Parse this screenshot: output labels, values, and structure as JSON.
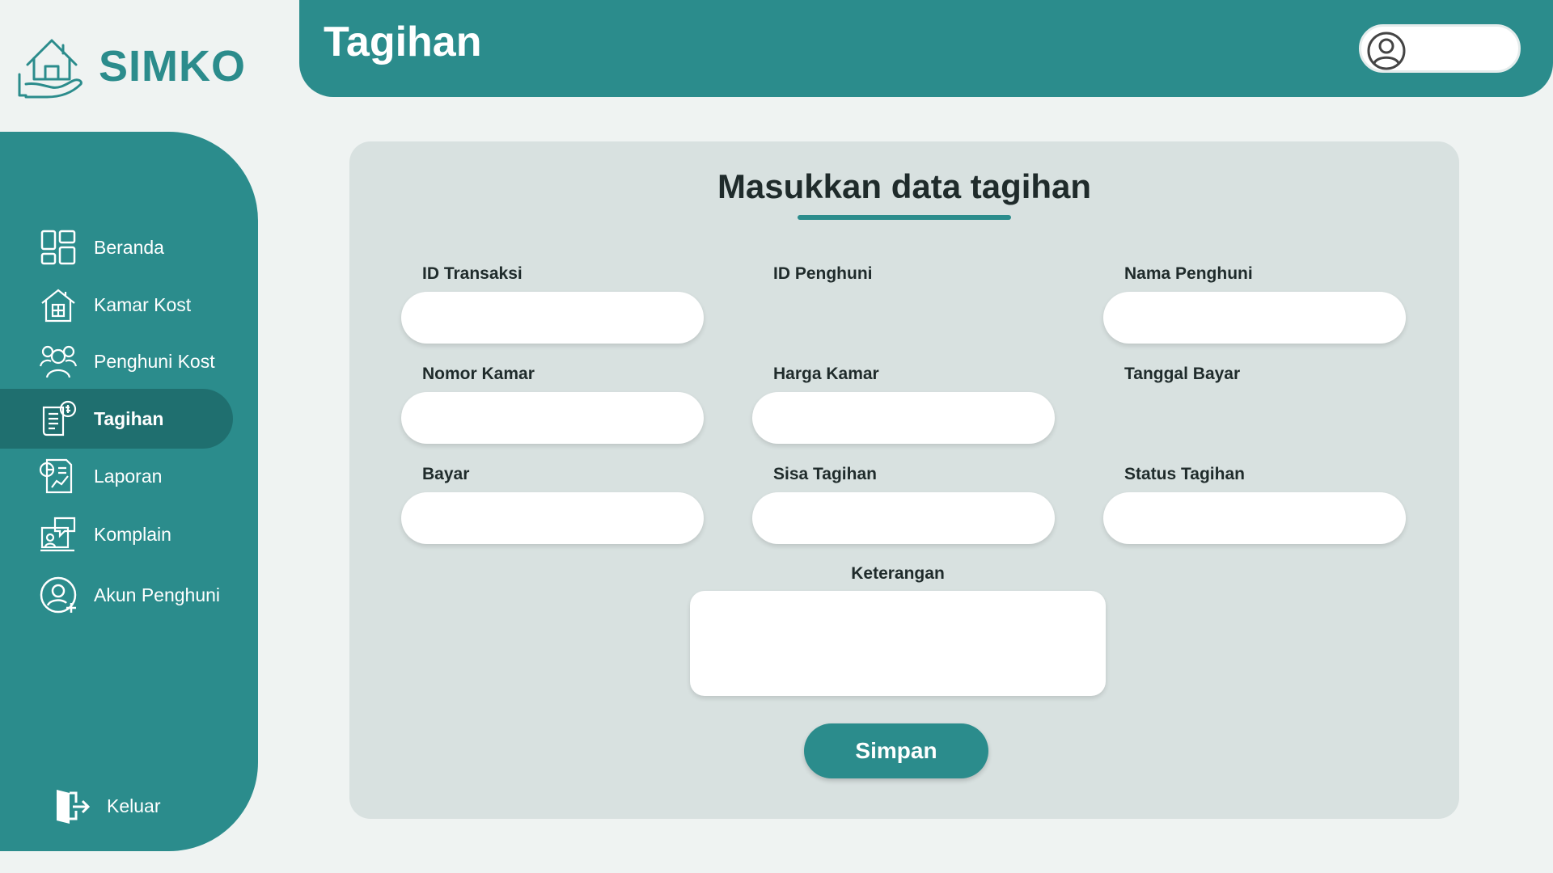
{
  "app": {
    "name": "SIMKO"
  },
  "header": {
    "title": "Tagihan"
  },
  "colors": {
    "primary": "#2b8c8c",
    "primary_dark": "#1f6f6f",
    "background": "#eff3f2",
    "card": "#d8e1e0"
  },
  "sidebar": {
    "items": [
      {
        "label": "Beranda",
        "icon": "dashboard-icon",
        "active": false
      },
      {
        "label": "Kamar Kost",
        "icon": "house-icon",
        "active": false
      },
      {
        "label": "Penghuni Kost",
        "icon": "users-icon",
        "active": false
      },
      {
        "label": "Tagihan",
        "icon": "invoice-icon",
        "active": true
      },
      {
        "label": "Laporan",
        "icon": "report-icon",
        "active": false
      },
      {
        "label": "Komplain",
        "icon": "complaint-icon",
        "active": false
      },
      {
        "label": "Akun Penghuni",
        "icon": "user-add-icon",
        "active": false
      }
    ],
    "logout": {
      "label": "Keluar",
      "icon": "logout-icon"
    }
  },
  "form": {
    "title": "Masukkan data tagihan",
    "fields": {
      "id_transaksi": {
        "label": "ID Transaksi",
        "value": ""
      },
      "id_penghuni": {
        "label": "ID Penghuni",
        "value": ""
      },
      "nama_penghuni": {
        "label": "Nama Penghuni",
        "value": ""
      },
      "nomor_kamar": {
        "label": "Nomor Kamar",
        "value": ""
      },
      "harga_kamar": {
        "label": "Harga Kamar",
        "value": ""
      },
      "tanggal_bayar": {
        "label": "Tanggal Bayar",
        "value": ""
      },
      "bayar": {
        "label": "Bayar",
        "value": ""
      },
      "sisa_tagihan": {
        "label": "Sisa Tagihan",
        "value": ""
      },
      "status_tagihan": {
        "label": "Status Tagihan",
        "value": ""
      },
      "keterangan": {
        "label": "Keterangan",
        "value": ""
      }
    },
    "submit_label": "Simpan"
  }
}
